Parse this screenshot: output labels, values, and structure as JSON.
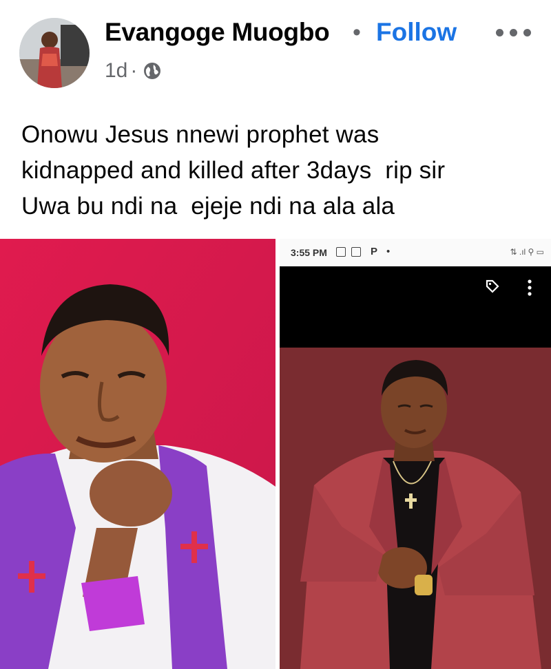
{
  "post": {
    "author": "Evangoge Muogbo",
    "separator": "•",
    "follow_label": "Follow",
    "time": "1d",
    "meta_dot": "·",
    "text_lines": [
      "Onowu Jesus nnewi prophet was",
      "kidnapped and killed after 3days  rip sir",
      "Uwa bu ndi na  ejeje ndi na ala ala"
    ]
  },
  "screenshot_statusbar": {
    "time": "3:55 PM",
    "app_letter": "P",
    "dot": "•",
    "right_indicators": "⇅ .ıl ⚲ ▭"
  },
  "icons": {
    "more": "more-options-icon",
    "audience": "globe-icon",
    "tag": "tag-icon",
    "menu": "kebab-menu-icon"
  },
  "colors": {
    "follow": "#1b74e4",
    "text": "#050505",
    "meta": "#65676b",
    "left_bg": "#d8204a",
    "right_bg": "#7a2c30"
  }
}
